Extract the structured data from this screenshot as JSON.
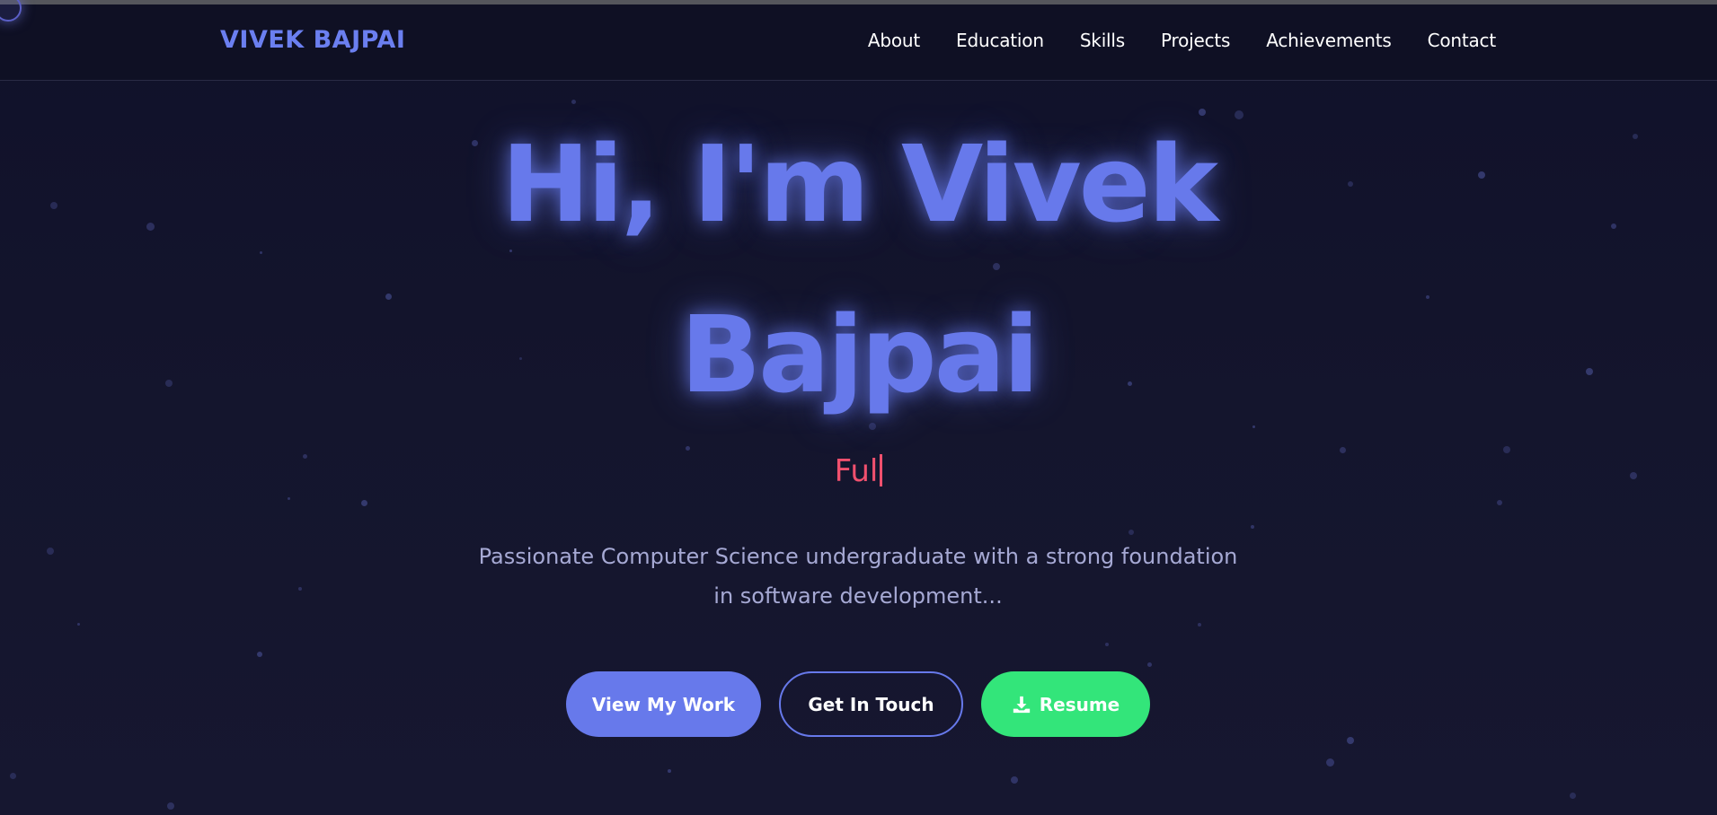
{
  "brand": "VIVEK BAJPAI",
  "nav": [
    {
      "label": "About"
    },
    {
      "label": "Education"
    },
    {
      "label": "Skills"
    },
    {
      "label": "Projects"
    },
    {
      "label": "Achievements"
    },
    {
      "label": "Contact"
    }
  ],
  "hero": {
    "title_line1": "Hi, I'm Vivek",
    "title_line2": "Bajpai",
    "typed_text": "Ful",
    "description_line1": "Passionate Computer Science undergraduate with a strong foundation",
    "description_line2": "in software development..."
  },
  "buttons": {
    "view_work": "View My Work",
    "get_in_touch": "Get In Touch",
    "resume": "Resume",
    "resume_icon": "download-icon"
  },
  "colors": {
    "accent": "#6779eb",
    "typed": "#f0506e",
    "resume_green": "#33e57a",
    "background": "#12132a"
  }
}
